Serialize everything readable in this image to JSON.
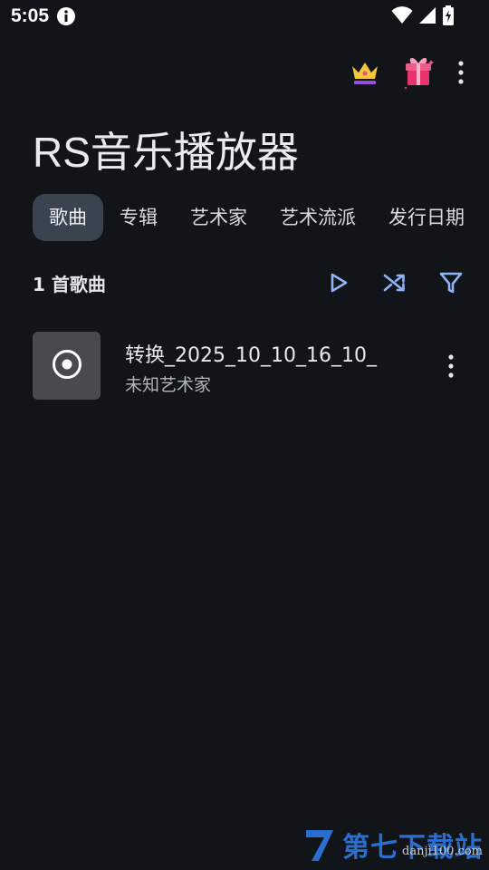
{
  "status_bar": {
    "time": "5:05"
  },
  "header": {
    "title": "RS音乐播放器"
  },
  "tabs": [
    {
      "label": "歌曲",
      "active": true
    },
    {
      "label": "专辑",
      "active": false
    },
    {
      "label": "艺术家",
      "active": false
    },
    {
      "label": "艺术流派",
      "active": false
    },
    {
      "label": "发行日期",
      "active": false
    }
  ],
  "list": {
    "count_label": "1 首歌曲"
  },
  "songs": [
    {
      "title": "转换_2025_10_10_16_10_",
      "artist": "未知艺术家"
    }
  ],
  "watermark": {
    "brand": "第七下载站",
    "url": "danji100.com"
  },
  "colors": {
    "background": "#111418",
    "accent": "#8fb4f5",
    "active_tab": "#3a4350"
  },
  "icons": [
    "info-icon",
    "wifi-icon",
    "signal-icon",
    "battery-icon",
    "crown-icon",
    "gift-icon",
    "more-vert-icon",
    "play-icon",
    "shuffle-icon",
    "filter-icon",
    "disc-icon"
  ]
}
